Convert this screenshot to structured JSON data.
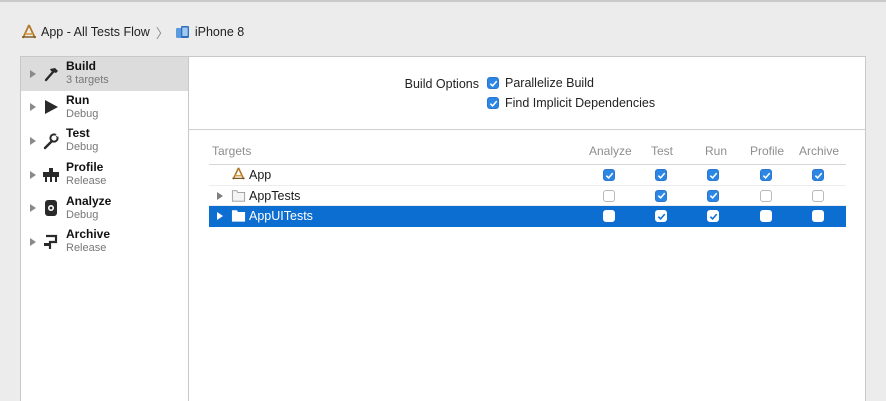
{
  "breadcrumb": {
    "scheme": "App - All Tests Flow",
    "device": "iPhone 8",
    "separator": "〉"
  },
  "sidebar": {
    "items": [
      {
        "title": "Build",
        "subtitle": "3 targets",
        "icon": "hammer-icon",
        "selected": true
      },
      {
        "title": "Run",
        "subtitle": "Debug",
        "icon": "play-icon",
        "selected": false
      },
      {
        "title": "Test",
        "subtitle": "Debug",
        "icon": "wrench-icon",
        "selected": false
      },
      {
        "title": "Profile",
        "subtitle": "Release",
        "icon": "gauge-icon",
        "selected": false
      },
      {
        "title": "Analyze",
        "subtitle": "Debug",
        "icon": "analyze-icon",
        "selected": false
      },
      {
        "title": "Archive",
        "subtitle": "Release",
        "icon": "archive-icon",
        "selected": false
      }
    ]
  },
  "build_options": {
    "label": "Build Options",
    "parallelize": {
      "label": "Parallelize Build",
      "checked": true
    },
    "implicit": {
      "label": "Find Implicit Dependencies",
      "checked": true
    }
  },
  "table": {
    "headers": {
      "targets": "Targets",
      "analyze": "Analyze",
      "test": "Test",
      "run": "Run",
      "profile": "Profile",
      "archive": "Archive"
    },
    "rows": [
      {
        "name": "App",
        "icon": "app-target-icon",
        "expandable": false,
        "selected": false,
        "analyze": true,
        "test": true,
        "run": true,
        "profile": true,
        "archive": true
      },
      {
        "name": "AppTests",
        "icon": "folder-icon",
        "expandable": true,
        "selected": false,
        "analyze": false,
        "test": true,
        "run": true,
        "profile": false,
        "archive": false
      },
      {
        "name": "AppUITests",
        "icon": "folder-icon",
        "expandable": true,
        "selected": true,
        "analyze": false,
        "test": true,
        "run": true,
        "profile": false,
        "archive": false
      }
    ]
  },
  "colors": {
    "selection": "#0d6ed1",
    "checkbox_accent": "#2b86e4",
    "sidebar_selected": "#dcdcdc"
  }
}
